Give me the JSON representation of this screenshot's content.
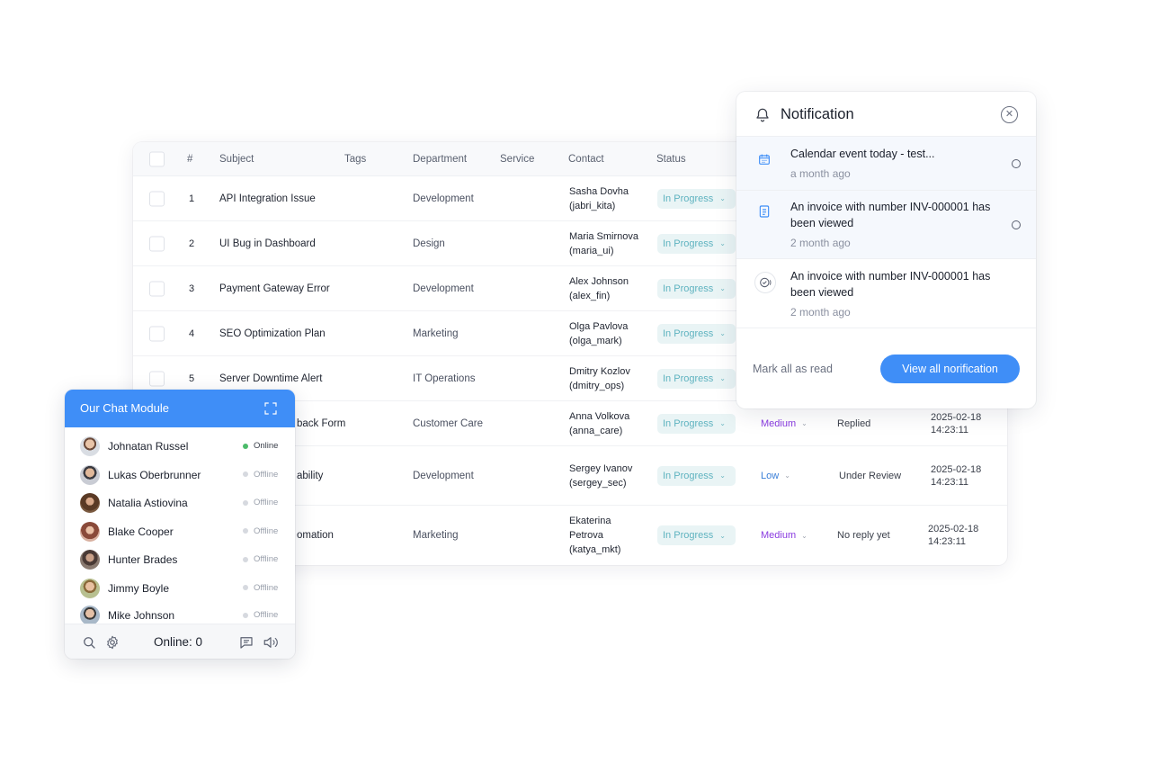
{
  "table": {
    "headers": {
      "num": "#",
      "subject": "Subject",
      "tags": "Tags",
      "department": "Department",
      "service": "Service",
      "contact": "Contact",
      "status": "Status"
    },
    "rows": [
      {
        "num": "1",
        "subject": "API Integration Issue",
        "department": "Development",
        "contact": "Sasha Dovha (jabri_kita)",
        "status": "In Progress"
      },
      {
        "num": "2",
        "subject": "UI Bug in Dashboard",
        "department": "Design",
        "contact": "Maria Smirnova (maria_ui)",
        "status": "In Progress"
      },
      {
        "num": "3",
        "subject": "Payment Gateway Error",
        "department": "Development",
        "contact": "Alex Johnson (alex_fin)",
        "status": "In Progress"
      },
      {
        "num": "4",
        "subject": "SEO Optimization Plan",
        "department": "Marketing",
        "contact": "Olga Pavlova (olga_mark)",
        "status": "In Progress"
      },
      {
        "num": "5",
        "subject": "Server Downtime Alert",
        "department": "IT Operations",
        "contact": "Dmitry Kozlov (dmitry_ops)",
        "status": "In Progress"
      },
      {
        "subject": "back Form",
        "department": "Customer Care",
        "contact": "Anna Volkova (anna_care)",
        "status": "In Progress",
        "priority": "Medium",
        "reply": "Replied",
        "date": "2025-02-18 14:23:11"
      },
      {
        "subject": "ability",
        "department": "Development",
        "contact": "Sergey Ivanov (sergey_sec)",
        "status": "In Progress",
        "priority": "Low",
        "reply": "Under Review",
        "date": "2025-02-18 14:23:11"
      },
      {
        "subject": "omation",
        "department": "Marketing",
        "contact": "Ekaterina Petrova (katya_mkt)",
        "status": "In Progress",
        "priority": "Medium",
        "reply": "No reply yet",
        "date": "2025-02-18 14:23:11"
      }
    ]
  },
  "notification": {
    "title": "Notification",
    "items": [
      {
        "text": "Calendar event today - test...",
        "time": "a month ago",
        "icon": "calendar-icon",
        "unread": true
      },
      {
        "text": "An invoice with number INV-000001 has been viewed",
        "time": "2 month ago",
        "icon": "document-icon",
        "unread": true
      },
      {
        "text": "An invoice with number INV-000001 has been viewed",
        "time": "2 month ago",
        "icon": "check-circle-icon",
        "unread": false
      }
    ],
    "mark_all_label": "Mark all as read",
    "view_all_label": "View all norification"
  },
  "chat": {
    "title": "Our Chat Module",
    "users": [
      {
        "name": "Johnatan Russel",
        "status": "Online"
      },
      {
        "name": "Lukas Oberbrunner",
        "status": "Offline"
      },
      {
        "name": "Natalia Astiovina",
        "status": "Offline"
      },
      {
        "name": "Blake Cooper",
        "status": "Offline"
      },
      {
        "name": "Hunter Brades",
        "status": "Offline"
      },
      {
        "name": "Jimmy Boyle",
        "status": "Offline"
      },
      {
        "name": "Mike Johnson",
        "status": "Offline"
      }
    ],
    "online_label": "Online: 0"
  },
  "colors": {
    "accent": "#3f8ef7",
    "status_bg": "#e9f4f5",
    "status_text": "#5fb3c0",
    "priority_medium": "#8a3be0",
    "priority_low": "#3a7fd8",
    "online": "#4cbb6a"
  }
}
